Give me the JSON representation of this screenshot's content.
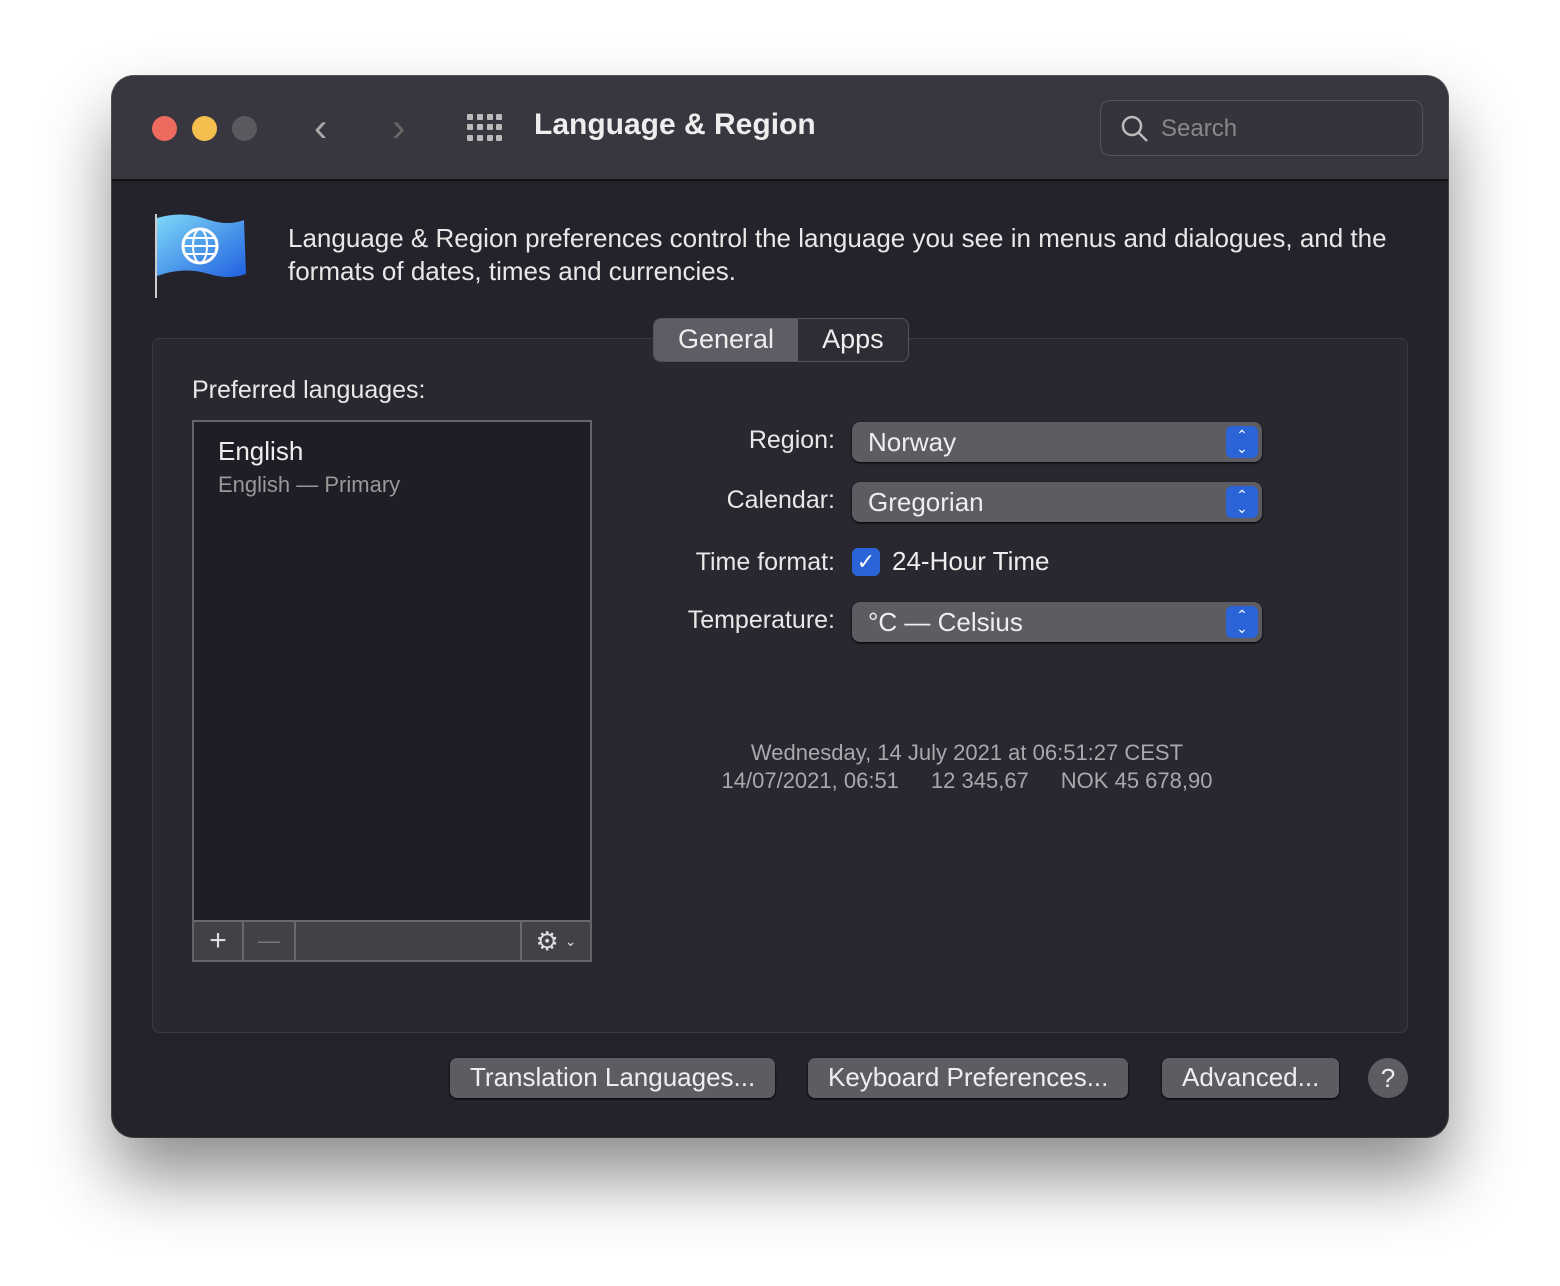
{
  "window": {
    "title": "Language & Region",
    "search_placeholder": "Search"
  },
  "description": "Language & Region preferences control the language you see in menus and dialogues, and the formats of dates, times and currencies.",
  "tabs": [
    {
      "label": "General",
      "selected": true
    },
    {
      "label": "Apps",
      "selected": false
    }
  ],
  "languages": {
    "label": "Preferred languages:",
    "items": [
      {
        "name": "English",
        "detail": "English — Primary"
      }
    ],
    "add": "+",
    "remove": "—"
  },
  "settings": {
    "region": {
      "label": "Region:",
      "value": "Norway"
    },
    "calendar": {
      "label": "Calendar:",
      "value": "Gregorian"
    },
    "time_format": {
      "label": "Time format:",
      "option": "24-Hour Time",
      "checked": true
    },
    "temperature": {
      "label": "Temperature:",
      "value": "°C — Celsius"
    }
  },
  "sample": {
    "line1": "Wednesday, 14 July 2021 at 06:51:27 CEST",
    "date_short": "14/07/2021, 06:51",
    "number": "12 345,67",
    "currency": "NOK 45 678,90"
  },
  "buttons": {
    "translation": "Translation Languages...",
    "keyboard": "Keyboard Preferences...",
    "advanced": "Advanced...",
    "help": "?"
  },
  "colors": {
    "accent": "#2a64d6",
    "close": "#ec6a5e",
    "minimize": "#f4bf4f"
  }
}
